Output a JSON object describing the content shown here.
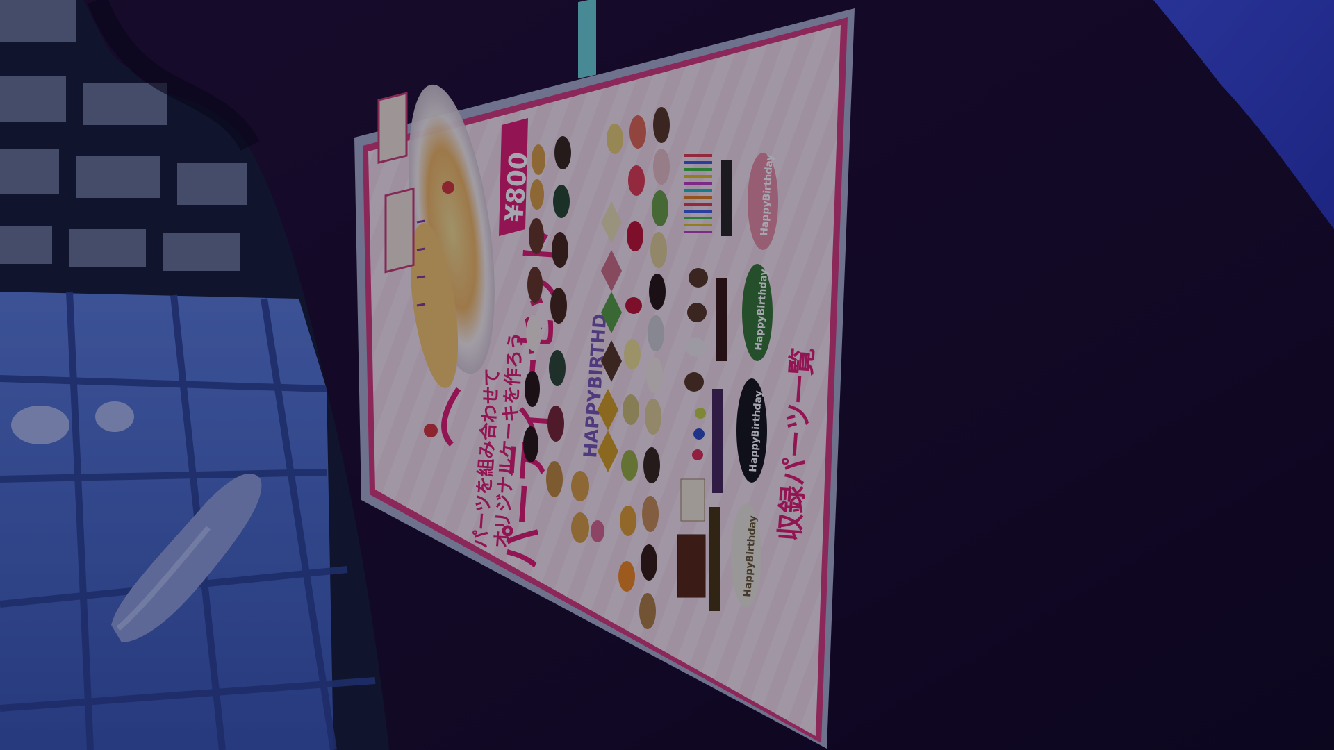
{
  "scene": {
    "colors": {
      "wall_purple": "#241231",
      "curtain_dark": "#120a20",
      "floor_blue": "#4a6bc3",
      "sky_blue": "#3b4bd0",
      "poster_bg": "#f1d9df",
      "poster_border": "#d23a78",
      "accent_pink": "#e0206e",
      "poster_frame": "#9ea6c0"
    },
    "icons": [
      "bubble-icon",
      "sausage-item",
      "cake-image",
      "cherry-icon",
      "star-icon",
      "heart-icon",
      "chocolate-bar-icon",
      "candle-icon",
      "macaron-icon"
    ]
  },
  "poster": {
    "title": "パーティーセット",
    "subtitle_line1": "パーツを組み合わせて",
    "subtitle_line2": "オリジナルケーキを作ろう",
    "price": "¥800",
    "section_title": "収録パーツ一覧",
    "banner_text": "HAPPYBIRTHD",
    "plate_text": "HappyBirthday",
    "plate_count": 5
  }
}
